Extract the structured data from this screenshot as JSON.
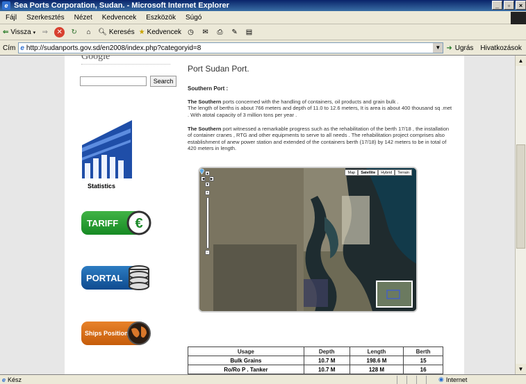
{
  "window": {
    "title": "Sea Ports Corporation, Sudan. - Microsoft Internet Explorer"
  },
  "menu": [
    "Fájl",
    "Szerkesztés",
    "Nézet",
    "Kedvencek",
    "Eszközök",
    "Súgó"
  ],
  "toolbar": {
    "back": "Vissza",
    "search": "Keresés",
    "favorites": "Kedvencek"
  },
  "address": {
    "label": "Cím",
    "url": "http://sudanports.gov.sd/en2008/index.php?categoryid=8",
    "go": "Ugrás",
    "links": "Hivatkozások"
  },
  "sidebar": {
    "google": "Google",
    "search_button": "Search",
    "stats_label": "Statistics",
    "tariff": "TARIFF",
    "portal": "PORTAL",
    "ships": "Ships Position"
  },
  "content": {
    "title": "Port Sudan Port.",
    "subtitle": "Southern Port :",
    "p1_lead": "The Southern",
    "p1_text": " ports concerned with the handling of containers, oil products and grain bulk .",
    "p1_line2": "The length of berths is about 766 meters and depth of 11.0 to 12.6 meters, It is area is about 400 thousand sq .met . With atotal capacity of 3 million tons per year .",
    "p2_lead": "The Southern",
    "p2_text": " port witnessed a remarkable progress such as the rehabilitation of the berth 17/18 , the installation of container cranes , RTG and other equipments to serve to all needs . The rehabilitation project comprises also establishment of anew power station and extended of the containers berth (17/18) by 142 meters to be in total of 420 meters in length."
  },
  "map": {
    "tabs": [
      "Map",
      "Satellite",
      "Hybrid",
      "Terrain"
    ],
    "active_tab": "Satellite"
  },
  "table": {
    "headers": [
      "Usage",
      "Depth",
      "Length",
      "Berth"
    ],
    "rows": [
      [
        "Bulk Grains",
        "10.7 M",
        "198.6 M",
        "15"
      ],
      [
        "Ro/Ro P . Tanker",
        "10.7 M",
        "128 M",
        "16"
      ]
    ]
  },
  "status": {
    "text": "Kész",
    "zone": "Internet"
  }
}
